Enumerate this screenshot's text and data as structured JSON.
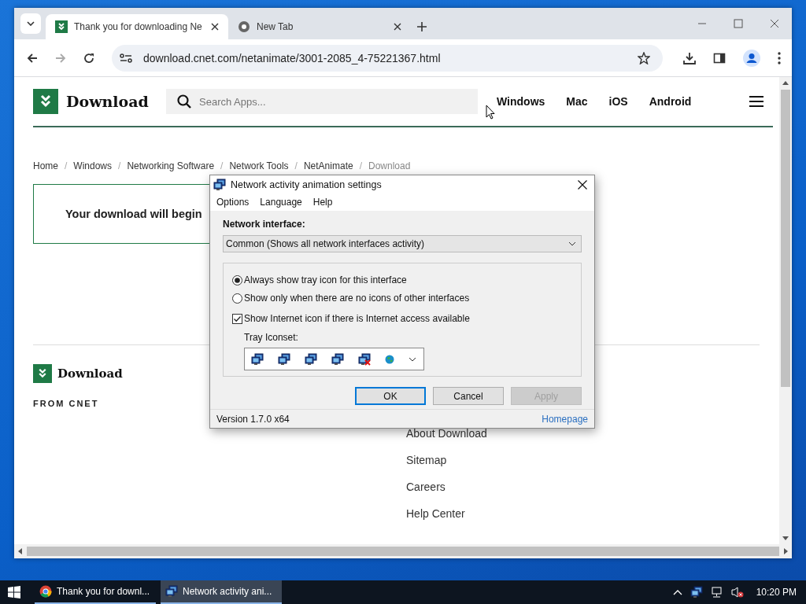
{
  "browser": {
    "tabs": [
      {
        "title": "Thank you for downloading Ne",
        "selected": true
      },
      {
        "title": "New Tab",
        "selected": false
      }
    ],
    "url": "download.cnet.com/netanimate/3001-2085_4-75221367.html"
  },
  "page": {
    "logo": "Download",
    "search": {
      "placeholder": "Search Apps..."
    },
    "nav": [
      "Windows",
      "Mac",
      "iOS",
      "Android"
    ],
    "breadcrumb_separator": "/",
    "breadcrumb": [
      {
        "label": "Home",
        "current": false
      },
      {
        "label": "Windows",
        "current": false
      },
      {
        "label": "Networking Software",
        "current": false
      },
      {
        "label": "Network Tools",
        "current": false
      },
      {
        "label": "NetAnimate",
        "current": false
      },
      {
        "label": "Download",
        "current": true
      }
    ],
    "download_message": "Your download will begin",
    "footer": {
      "logo": "Download",
      "heading": "FROM CNET",
      "links": [
        "About Download",
        "Sitemap",
        "Careers",
        "Help Center"
      ]
    }
  },
  "dialog": {
    "title": "Network activity animation settings",
    "menu": [
      "Options",
      "Language",
      "Help"
    ],
    "interface_label": "Network interface:",
    "interface_value": "Common (Shows all network interfaces activity)",
    "options": [
      {
        "kind": "radio",
        "label": "Always show tray icon for this interface",
        "selected": true
      },
      {
        "kind": "radio",
        "label": "Show only when there are no icons of other interfaces",
        "selected": false
      },
      {
        "kind": "checkbox",
        "label": "Show Internet icon if there is Internet access available",
        "checked": true
      }
    ],
    "iconset_label": "Tray Iconset:",
    "buttons": [
      {
        "label": "OK",
        "default": true,
        "disabled": false
      },
      {
        "label": "Cancel",
        "default": false,
        "disabled": false
      },
      {
        "label": "Apply",
        "default": false,
        "disabled": true
      }
    ],
    "version": "Version 1.7.0 x64",
    "homepage": "Homepage"
  },
  "taskbar": {
    "items": [
      {
        "label": "Thank you for downl...",
        "selected": false
      },
      {
        "label": "Network activity ani...",
        "selected": true
      }
    ],
    "clock": "10:20 PM"
  }
}
